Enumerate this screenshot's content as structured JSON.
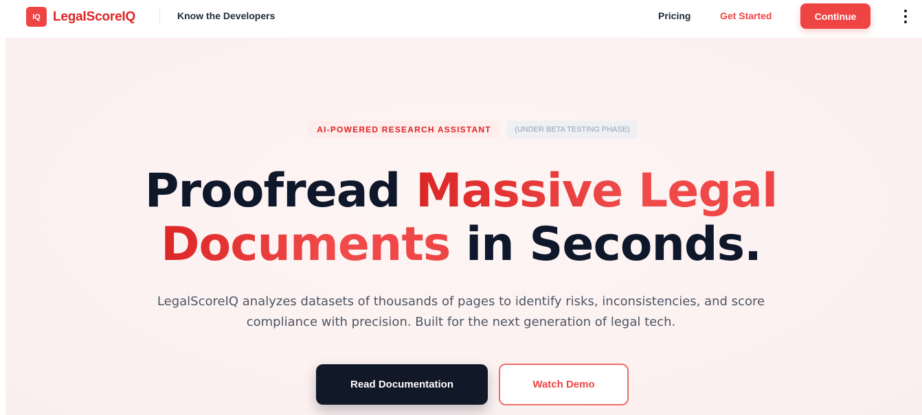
{
  "nav": {
    "logo_badge": "IQ",
    "brand": "LegalScoreIQ",
    "know_developers": "Know the Developers",
    "pricing": "Pricing",
    "get_started": "Get Started",
    "continue": "Continue",
    "more_icon": "kebab-vertical-icon"
  },
  "hero": {
    "tag_primary": "AI-POWERED RESEARCH ASSISTANT",
    "tag_secondary": "(UNDER BETA TESTING PHASE)",
    "headline": {
      "part1": "Proofread ",
      "part2": "Massive Legal",
      "part3": "Documents",
      "part4": " in Seconds."
    },
    "subtext": "LegalScoreIQ analyzes datasets of thousands of pages to identify risks, inconsistencies, and score compliance with precision. Built for the next generation of legal tech.",
    "primary_button": "Read Documentation",
    "secondary_button": "Watch Demo"
  },
  "colors": {
    "accent": "#ef4444",
    "dark": "#111827",
    "hero_bg": "#fdf2f2"
  }
}
